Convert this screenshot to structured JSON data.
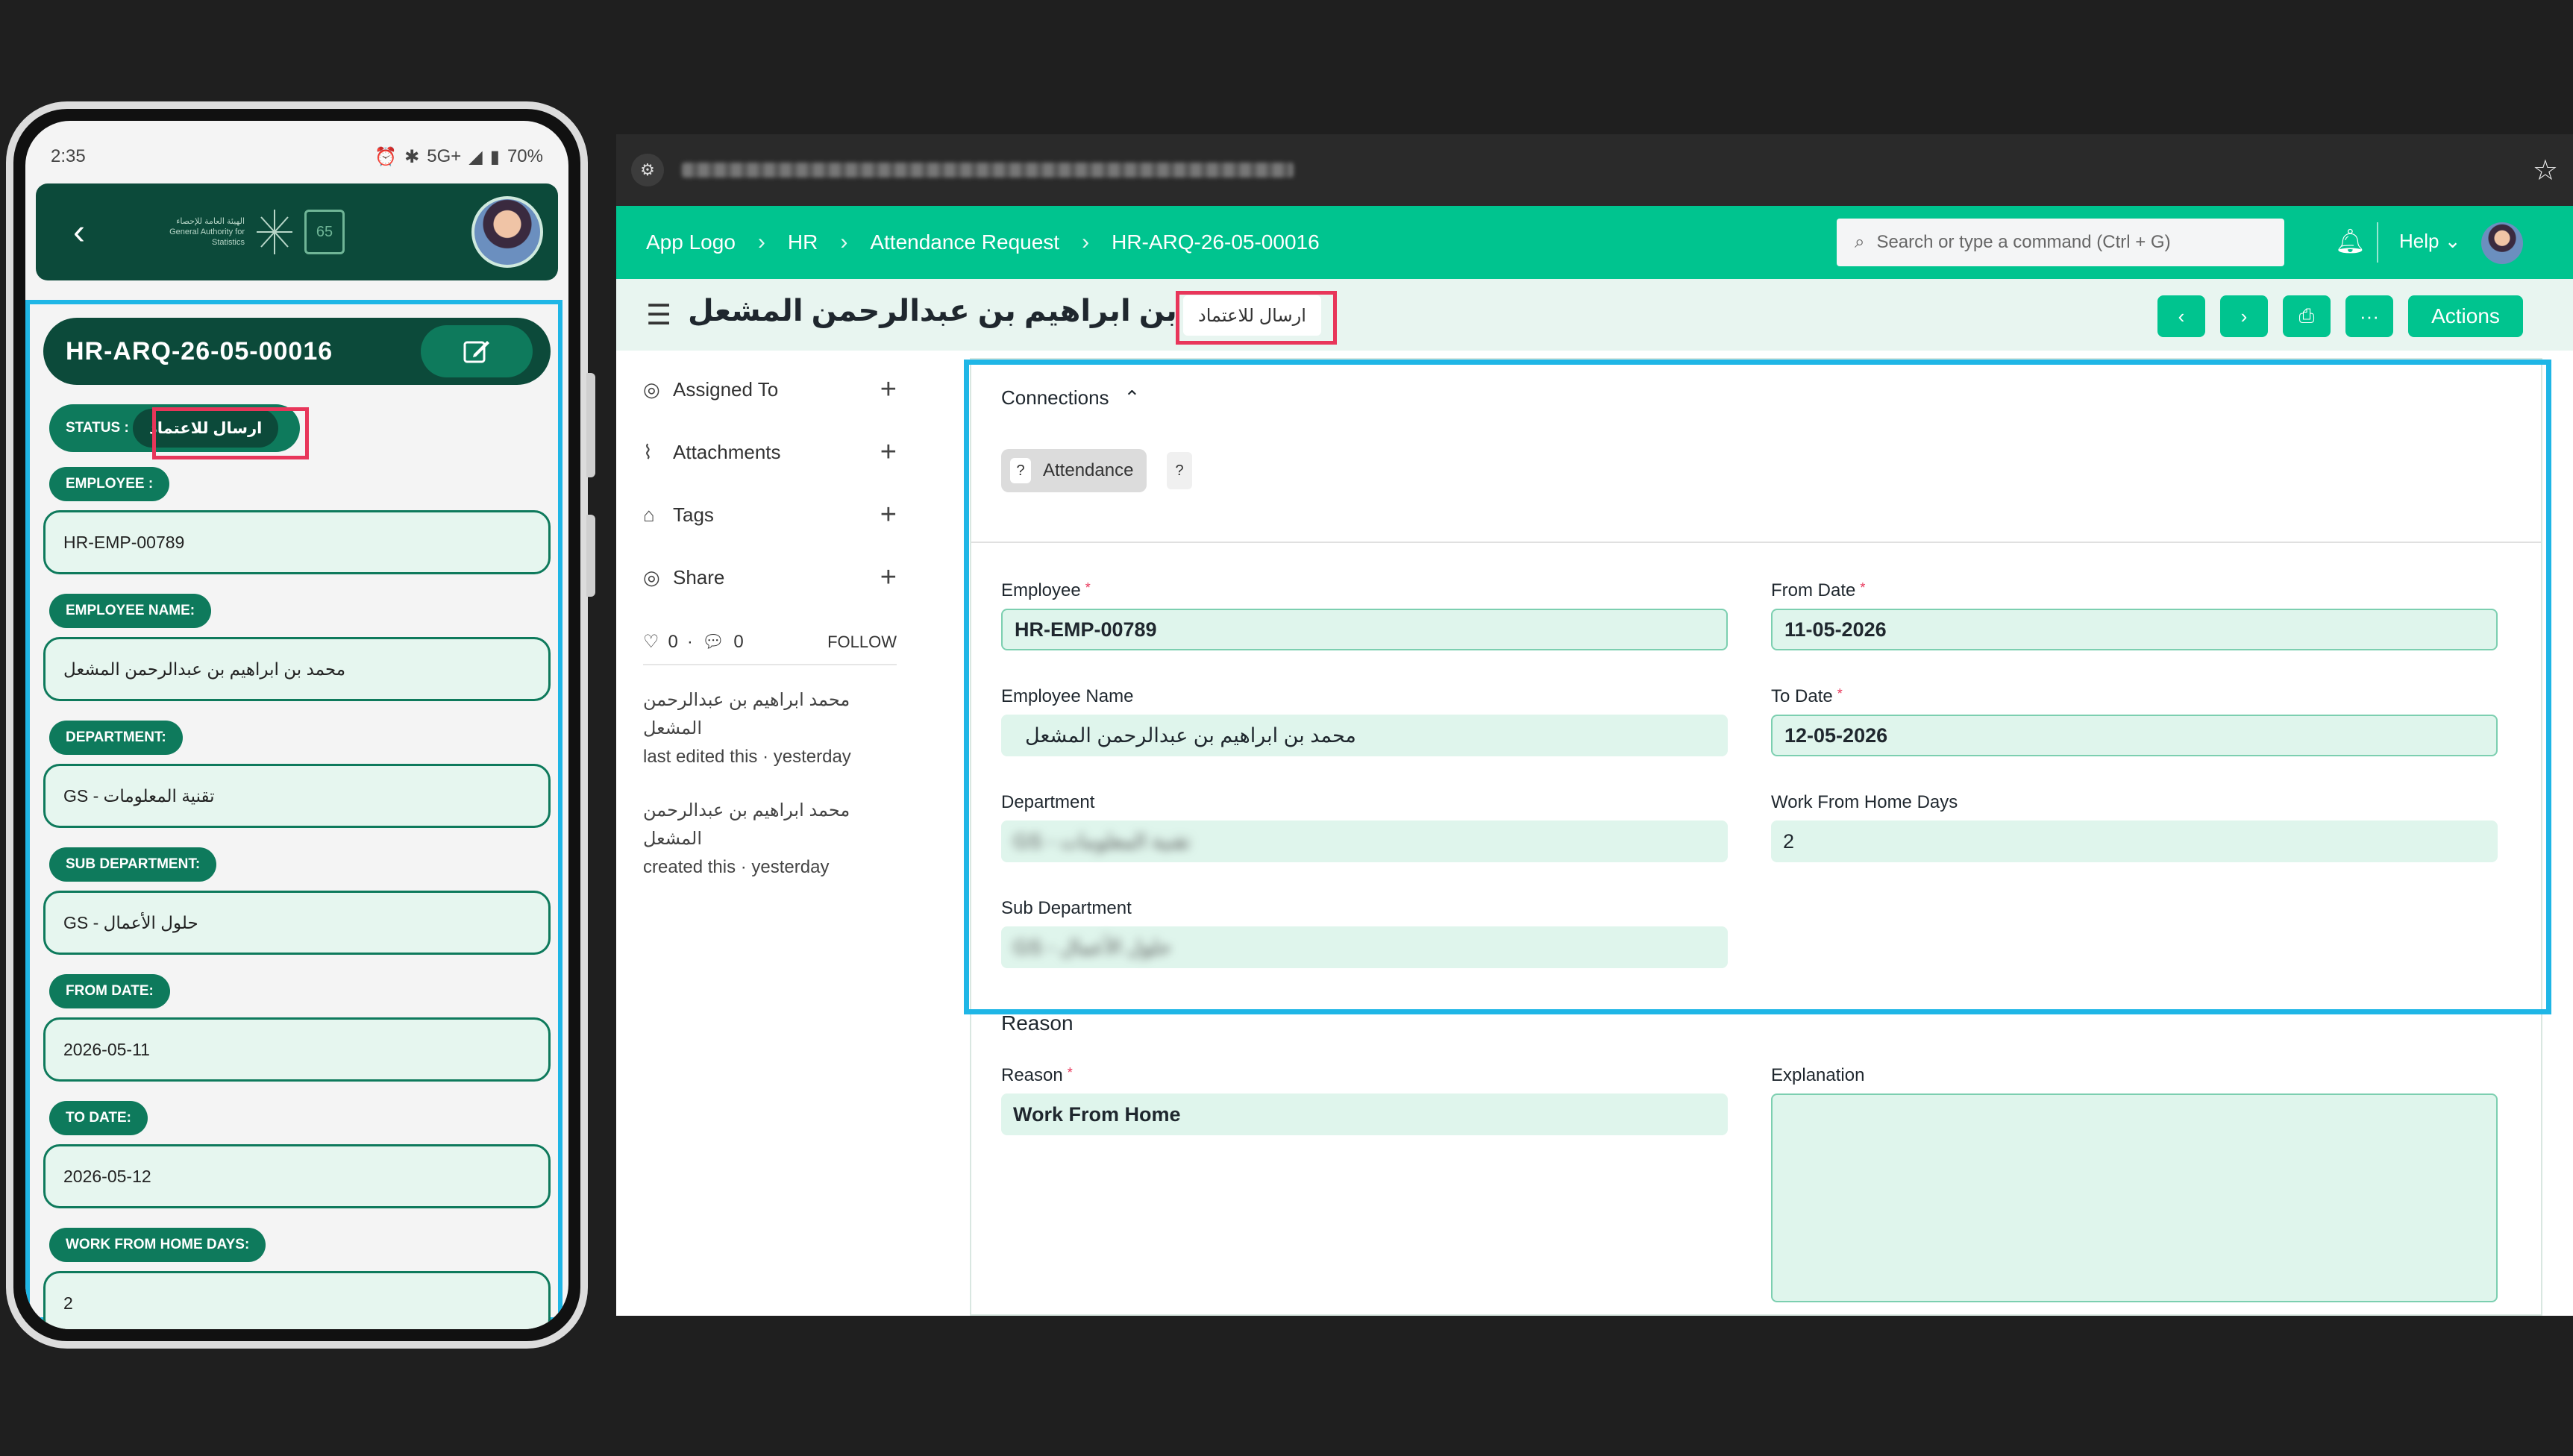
{
  "phone": {
    "status_bar": {
      "time": "2:35",
      "battery": "70%",
      "network": "5G+"
    },
    "header": {
      "back_icon": "chevron-left-icon",
      "org_logo_text": "الهيئة العامة للإحصاء General Authority for Statistics",
      "years_badge": "65"
    },
    "doc_title": "HR-ARQ-26-05-00016",
    "status_label": "STATUS :",
    "status_value": "ارسال للاعتماد",
    "fields": [
      {
        "label": "EMPLOYEE :",
        "value": "HR-EMP-00789"
      },
      {
        "label": "EMPLOYEE NAME:",
        "value": "محمد بن ابراهيم بن عبدالرحمن المشعل"
      },
      {
        "label": "DEPARTMENT:",
        "value": "GS - تقنية المعلومات"
      },
      {
        "label": "SUB DEPARTMENT:",
        "value": "GS - حلول الأعمال"
      },
      {
        "label": "FROM DATE:",
        "value": "2026-05-11"
      },
      {
        "label": "TO DATE:",
        "value": "2026-05-12"
      },
      {
        "label": "WORK FROM HOME DAYS:",
        "value": "2"
      }
    ]
  },
  "browser": {
    "url_blurred": "",
    "nav": {
      "logo_alt": "App Logo",
      "breadcrumbs": [
        "HR",
        "Attendance Request",
        "HR-ARQ-26-05-00016"
      ],
      "search_placeholder": "Search or type a command (Ctrl + G)",
      "help": "Help"
    },
    "page": {
      "title": "محمد بن ابراهيم بن عبدالرحمن المشعل",
      "status_indicator": "ارسال للاعتماد",
      "actions_label": "Actions",
      "more_label": "···"
    },
    "sidebar": {
      "items": [
        "Assigned To",
        "Attachments",
        "Tags",
        "Share"
      ],
      "likes": "0",
      "comments": "0",
      "follow": "FOLLOW",
      "activity": [
        {
          "name": "محمد ابراهيم بن عبدالرحمن المشعل",
          "action": "last edited this · yesterday"
        },
        {
          "name": "محمد ابراهيم بن عبدالرحمن المشعل",
          "action": "created this · yesterday"
        }
      ]
    },
    "form": {
      "connections_title": "Connections",
      "connection_chip": "Attendance",
      "chip_q": "?",
      "employee_label": "Employee",
      "employee_value": "HR-EMP-00789",
      "employee_name_label": "Employee Name",
      "employee_name_value": "محمد بن ابراهيم بن عبدالرحمن المشعل",
      "department_label": "Department",
      "department_value": "GS - تقنية المعلومات",
      "sub_department_label": "Sub Department",
      "sub_department_value": "GS - حلول الأعمال",
      "from_date_label": "From Date",
      "from_date_value": "11-05-2026",
      "to_date_label": "To Date",
      "to_date_value": "12-05-2026",
      "wfh_days_label": "Work From Home Days",
      "wfh_days_value": "2",
      "reason_section": "Reason",
      "reason_label": "Reason",
      "reason_value": "Work From Home",
      "explanation_label": "Explanation",
      "explanation_value": ""
    }
  },
  "colors": {
    "primary": "#00c48f",
    "dark_green": "#0c4a3a",
    "highlight_blue": "#1fb6e6",
    "highlight_red": "#e8365a"
  }
}
